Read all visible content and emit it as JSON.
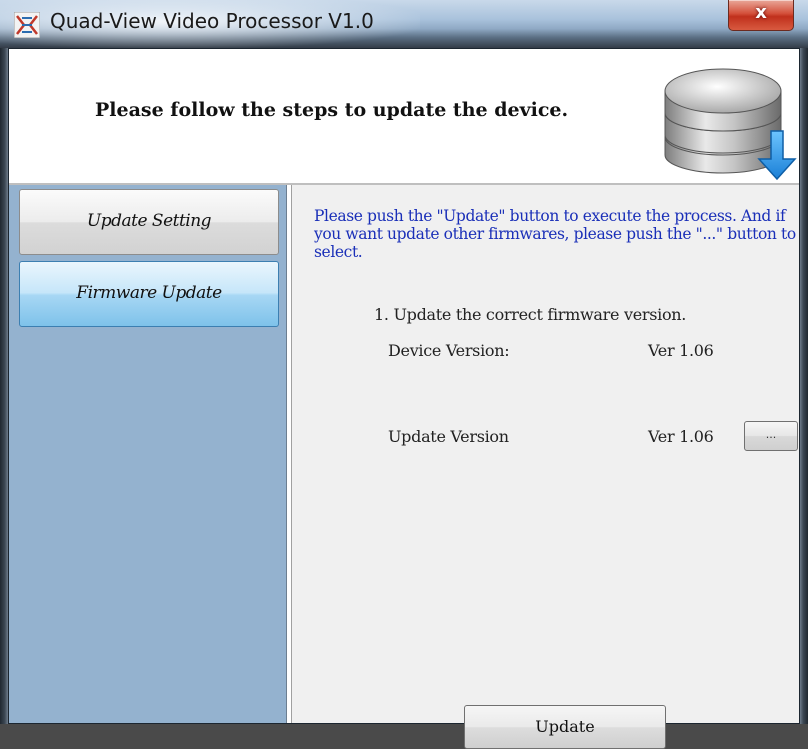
{
  "window": {
    "title": "Quad-View Video Processor V1.0",
    "close_label": "x"
  },
  "header": {
    "text": "Please follow the steps to update the device.",
    "icon": "database-download-icon"
  },
  "sidebar": {
    "items": [
      {
        "label": "Update Setting",
        "selected": false
      },
      {
        "label": "Firmware Update",
        "selected": true
      }
    ]
  },
  "panel": {
    "instruction": "Please push the \"Update\" button to execute the process. And if you want update other firmwares, please push the \"...\" button to select.",
    "step": "1. Update the correct firmware version.",
    "device_version_label": "Device Version:",
    "device_version_value": "Ver 1.06",
    "update_version_label": "Update Version",
    "update_version_value": "Ver 1.06",
    "browse_label": "...",
    "update_button_label": "Update"
  },
  "colors": {
    "instruction_text": "#1a2fb8",
    "sidebar_bg": "#94b2cf",
    "selected_item": "#a7d7f4"
  }
}
